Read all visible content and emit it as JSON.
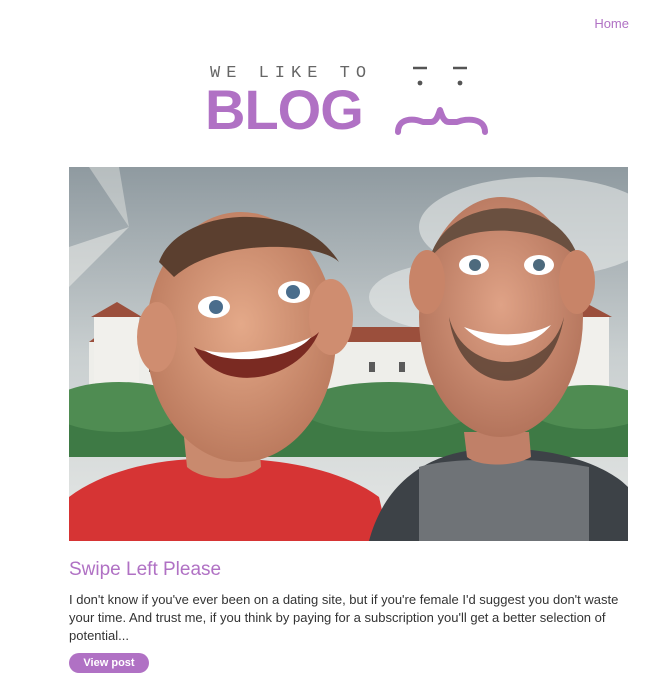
{
  "nav": {
    "home_label": "Home"
  },
  "logo": {
    "tagline": "WE LIKE TO",
    "wordmark": "BLOG",
    "accent_color": "#b071c4"
  },
  "post": {
    "title": "Swipe Left Please",
    "excerpt": "I don't know if you've ever been on a dating site, but if you're female I'd suggest you don't waste your time. And trust me, if you think by paying for a subscription you'll get a better selection of potential...",
    "button_label": "View post"
  }
}
